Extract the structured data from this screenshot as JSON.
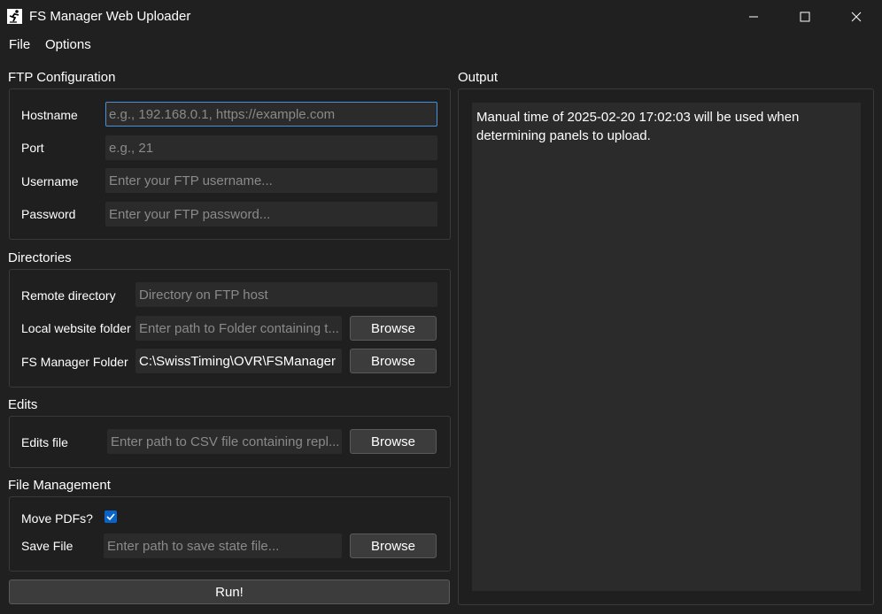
{
  "window": {
    "title": "FS Manager Web Uploader"
  },
  "menu": {
    "file": "File",
    "options": "Options"
  },
  "ftp": {
    "title": "FTP Configuration",
    "hostname_label": "Hostname",
    "hostname_placeholder": "e.g., 192.168.0.1, https://example.com",
    "hostname_value": "",
    "port_label": "Port",
    "port_placeholder": "e.g., 21",
    "username_label": "Username",
    "username_placeholder": "Enter your FTP username...",
    "password_label": "Password",
    "password_placeholder": "Enter your FTP password..."
  },
  "directories": {
    "title": "Directories",
    "remote_label": "Remote directory",
    "remote_placeholder": "Directory on FTP host",
    "local_label": "Local website folder",
    "local_placeholder": "Enter path to Folder containing t...",
    "local_browse": "Browse",
    "fsm_label": "FS Manager Folder",
    "fsm_value": "C:\\SwissTiming\\OVR\\FSManager",
    "fsm_browse": "Browse"
  },
  "edits": {
    "title": "Edits",
    "file_label": "Edits file",
    "file_placeholder": "Enter path to CSV file containing repl...",
    "browse": "Browse"
  },
  "file_management": {
    "title": "File Management",
    "move_pdfs_label": "Move PDFs?",
    "move_pdfs_checked": true,
    "save_label": "Save File",
    "save_placeholder": "Enter path to save state file...",
    "browse": "Browse"
  },
  "run_label": "Run!",
  "output": {
    "title": "Output",
    "text": "Manual time of 2025-02-20 17:02:03 will be used when determining panels to upload."
  }
}
